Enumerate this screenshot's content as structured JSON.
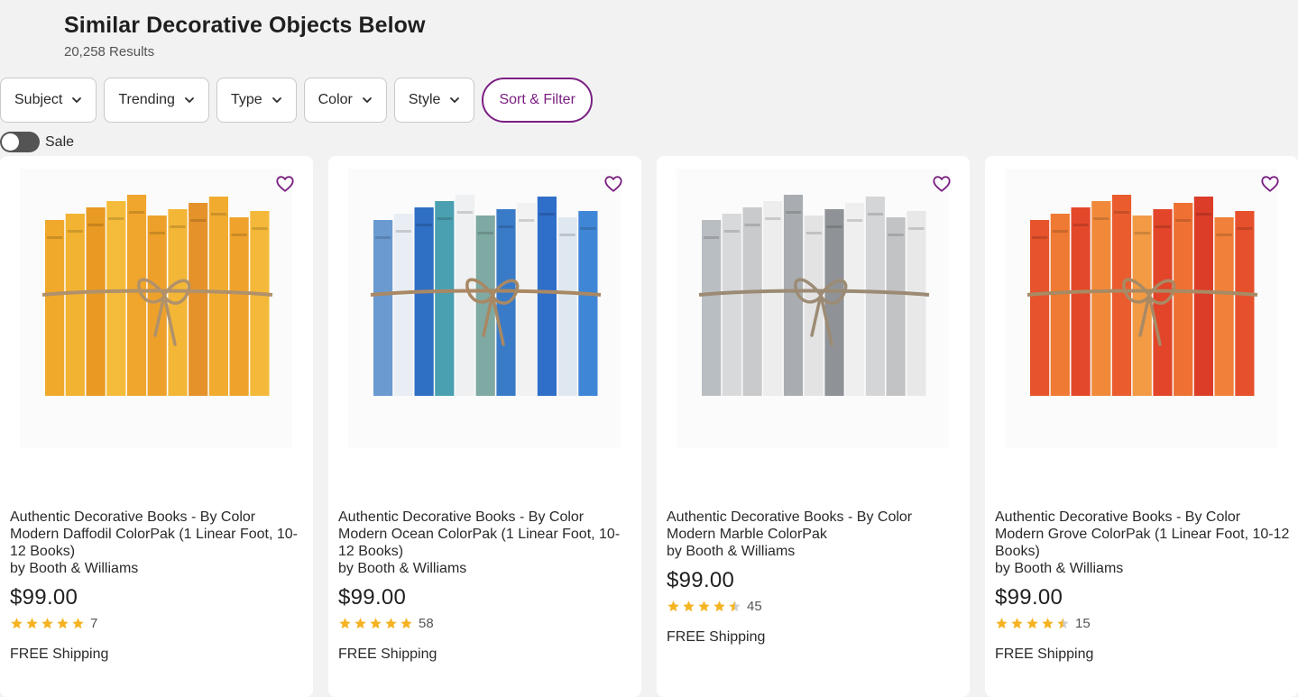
{
  "header": {
    "title": "Similar Decorative Objects Below",
    "results": "20,258 Results"
  },
  "filters": {
    "subject": "Subject",
    "trending": "Trending",
    "type": "Type",
    "color": "Color",
    "style": "Style",
    "sort": "Sort & Filter"
  },
  "sale": {
    "label": "Sale",
    "on": false
  },
  "colors": {
    "accent": "#7b1f82",
    "star": "#f5b323",
    "star_empty": "#cfcfcf"
  },
  "products": [
    {
      "name": "Authentic Decorative Books - By Color Modern Daffodil ColorPak (1 Linear Foot, 10-12 Books)",
      "brand": "by Booth & Williams",
      "price": "$99.00",
      "rating": 5,
      "reviews": "7",
      "shipping": "FREE Shipping",
      "palette": [
        "#f0a92a",
        "#f2b332",
        "#e89a22",
        "#f4bc3a",
        "#f0a52c",
        "#eea12a",
        "#f3b637",
        "#e6922a",
        "#f1ac30",
        "#efa32c",
        "#f4b93a"
      ],
      "twine": "#b0916b"
    },
    {
      "name": "Authentic Decorative Books - By Color Modern Ocean ColorPak (1 Linear Foot, 10-12 Books)",
      "brand": "by Booth & Williams",
      "price": "$99.00",
      "rating": 5,
      "reviews": "58",
      "shipping": "FREE Shipping",
      "palette": [
        "#6a9ad0",
        "#e9eef4",
        "#2f6fc4",
        "#4aa0b0",
        "#eef0f2",
        "#7fa9a3",
        "#3a7bc8",
        "#f2f2f2",
        "#2f6ec9",
        "#dfe8f0",
        "#3f86d6"
      ],
      "twine": "#a98864"
    },
    {
      "name": "Authentic Decorative Books - By Color Modern Marble ColorPak",
      "brand": "by Booth & Williams",
      "price": "$99.00",
      "rating": 4.5,
      "reviews": "45",
      "shipping": "FREE Shipping",
      "palette": [
        "#b9bec3",
        "#d7d9db",
        "#c8cacc",
        "#ededed",
        "#a9adb1",
        "#e3e3e3",
        "#8f9397",
        "#efefef",
        "#d3d5d7",
        "#c1c3c5",
        "#e8e8e8"
      ],
      "twine": "#9c8b74"
    },
    {
      "name": "Authentic Decorative Books - By Color Modern Grove ColorPak (1 Linear Foot, 10-12 Books)",
      "brand": "by Booth & Williams",
      "price": "$99.00",
      "rating": 4.5,
      "reviews": "15",
      "shipping": "FREE Shipping",
      "palette": [
        "#e6532c",
        "#ef7a33",
        "#e4482a",
        "#f08a3a",
        "#ea5c2e",
        "#f29a44",
        "#e2452a",
        "#ee7033",
        "#dc3d28",
        "#f0803a",
        "#e6502c"
      ],
      "twine": "#a88a64"
    }
  ]
}
